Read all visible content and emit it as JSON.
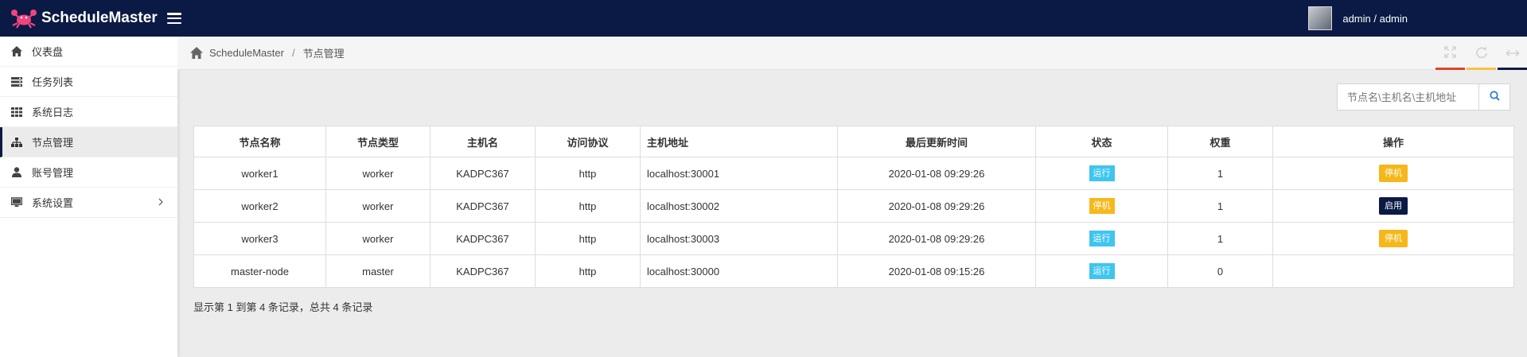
{
  "navbar": {
    "brand_name": "ScheduleMaster",
    "user_label": "admin / admin",
    "bg_color": "#0b1a44"
  },
  "sidebar": {
    "items": [
      {
        "label": "仪表盘",
        "icon": "home-icon"
      },
      {
        "label": "任务列表",
        "icon": "tasks-icon"
      },
      {
        "label": "系统日志",
        "icon": "grid-icon"
      },
      {
        "label": "节点管理",
        "icon": "sitemap-icon",
        "active": true
      },
      {
        "label": "账号管理",
        "icon": "user-icon"
      },
      {
        "label": "系统设置",
        "icon": "monitor-icon",
        "has_submenu": true
      }
    ]
  },
  "breadcrumb": {
    "home": "ScheduleMaster",
    "separator": "/",
    "current": "节点管理"
  },
  "toolbar": {
    "fullscreen_color": "#e0442a",
    "refresh_color": "#f7c247",
    "collapse_color": "#0b1a44"
  },
  "search": {
    "placeholder": "节点名\\主机名\\主机地址",
    "value": ""
  },
  "table": {
    "headers": [
      "节点名称",
      "节点类型",
      "主机名",
      "访问协议",
      "主机地址",
      "最后更新时间",
      "状态",
      "权重",
      "操作"
    ],
    "rows": [
      {
        "name": "worker1",
        "type": "worker",
        "host": "KADPC367",
        "protocol": "http",
        "address": "localhost:30001",
        "updated": "2020-01-08 09:29:26",
        "status": "运行",
        "status_kind": "run",
        "weight": "1",
        "action": "停机",
        "action_kind": "stop"
      },
      {
        "name": "worker2",
        "type": "worker",
        "host": "KADPC367",
        "protocol": "http",
        "address": "localhost:30002",
        "updated": "2020-01-08 09:29:26",
        "status": "停机",
        "status_kind": "stop",
        "weight": "1",
        "action": "启用",
        "action_kind": "enable"
      },
      {
        "name": "worker3",
        "type": "worker",
        "host": "KADPC367",
        "protocol": "http",
        "address": "localhost:30003",
        "updated": "2020-01-08 09:29:26",
        "status": "运行",
        "status_kind": "run",
        "weight": "1",
        "action": "停机",
        "action_kind": "stop"
      },
      {
        "name": "master-node",
        "type": "master",
        "host": "KADPC367",
        "protocol": "http",
        "address": "localhost:30000",
        "updated": "2020-01-08 09:15:26",
        "status": "运行",
        "status_kind": "run",
        "weight": "0",
        "action": "",
        "action_kind": "none"
      }
    ]
  },
  "footer": {
    "summary": "显示第 1 到第 4 条记录，总共 4 条记录"
  }
}
